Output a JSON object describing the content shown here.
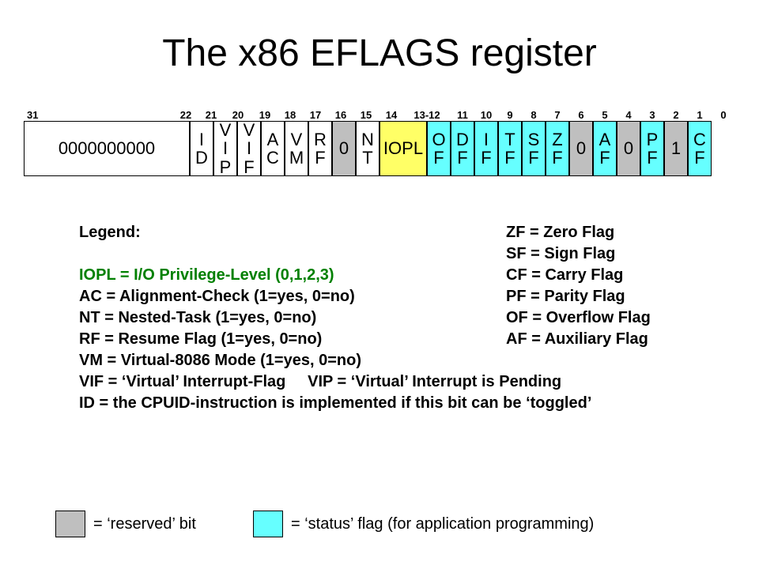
{
  "title": "The x86 EFLAGS register",
  "bit_indices": {
    "b31": "31",
    "b22": "22",
    "b21": "21",
    "b20": "20",
    "b19": "19",
    "b18": "18",
    "b17": "17",
    "b16": "16",
    "b15": "15",
    "b14": "14",
    "b13_12": "13-12",
    "b11": "11",
    "b10": "10",
    "b9": "9",
    "b8": "8",
    "b7": "7",
    "b6": "6",
    "b5": "5",
    "b4": "4",
    "b3": "3",
    "b2": "2",
    "b1": "1",
    "b0": "0"
  },
  "cells": {
    "reserved_high": "0000000000",
    "id": "I\nD",
    "vip": "V\nI\nP",
    "vif": "V\nI\nF",
    "ac": "A\nC",
    "vm": "V\nM",
    "rf": "R\nF",
    "r15": "0",
    "nt": "N\nT",
    "iopl": "IOPL",
    "of": "O\nF",
    "df": "D\nF",
    "if": "I\nF",
    "tf": "T\nF",
    "sf": "S\nF",
    "zf": "Z\nF",
    "r5": "0",
    "af": "A\nF",
    "r3": "0",
    "pf": "P\nF",
    "r1": "1",
    "cf": "C\nF"
  },
  "legend": {
    "heading": "Legend:",
    "iopl": "IOPL = I/O Privilege-Level (0,1,2,3)",
    "ac": "AC = Alignment-Check (1=yes, 0=no)",
    "nt": "NT = Nested-Task (1=yes, 0=no)",
    "rf": "RF = Resume Flag (1=yes, 0=no)",
    "vm": "VM = Virtual-8086 Mode (1=yes, 0=no)",
    "vif_vip": "VIF = ‘Virtual’ Interrupt-Flag     VIP = ‘Virtual’ Interrupt is Pending",
    "id": "ID = the CPUID-instruction is implemented if this bit can be ‘toggled’",
    "zf": "ZF = Zero Flag",
    "sf": "SF = Sign Flag",
    "cf": "CF = Carry Flag",
    "pf": "PF = Parity Flag",
    "of": "OF = Overflow Flag",
    "af": "AF = Auxiliary Flag"
  },
  "swatch": {
    "reserved": "= ‘reserved’ bit",
    "status": "= ‘status’ flag (for application programming)"
  },
  "colors": {
    "reserved": "#bfbfbf",
    "status": "#66ffff",
    "iopl": "#ffff66"
  }
}
